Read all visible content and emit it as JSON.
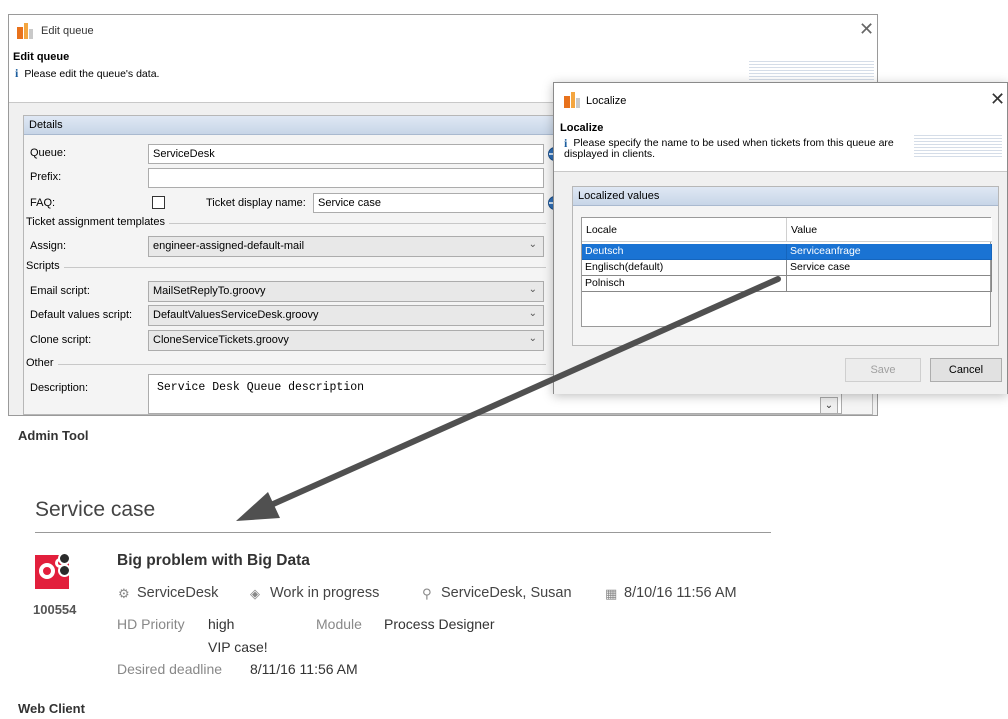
{
  "edit_window": {
    "title": "Edit queue",
    "header_title": "Edit queue",
    "header_text": "Please edit the queue's data.",
    "panel_title": "Details",
    "queue_label": "Queue:",
    "queue_value": "ServiceDesk",
    "prefix_label": "Prefix:",
    "prefix_value": "",
    "faq_label": "FAQ:",
    "faq_checked": false,
    "ticket_display_label": "Ticket display name:",
    "ticket_display_value": "Service case",
    "section_templates": "Ticket assignment templates",
    "assign_label": "Assign:",
    "assign_value": "engineer-assigned-default-mail",
    "section_scripts": "Scripts",
    "email_script_label": "Email script:",
    "email_script_value": "MailSetReplyTo.groovy",
    "default_script_label": "Default values script:",
    "default_script_value": "DefaultValuesServiceDesk.groovy",
    "clone_script_label": "Clone script:",
    "clone_script_value": "CloneServiceTickets.groovy",
    "section_other": "Other",
    "description_label": "Description:",
    "description_value": "Service Desk Queue description"
  },
  "localize_dialog": {
    "title": "Localize",
    "header_title": "Localize",
    "header_text": "Please specify the name to be used when tickets from this queue are displayed in clients.",
    "panel_title": "Localized values",
    "columns": [
      "Locale",
      "Value"
    ],
    "rows": [
      {
        "locale": "Deutsch",
        "value": "Serviceanfrage",
        "selected": true
      },
      {
        "locale": "Englisch(default)",
        "value": "Service case",
        "selected": false
      },
      {
        "locale": "Polnisch",
        "value": "",
        "selected": false
      }
    ],
    "save_label": "Save",
    "cancel_label": "Cancel"
  },
  "captions": {
    "admin_tool": "Admin Tool",
    "web_client": "Web Client"
  },
  "web_client": {
    "section_title": "Service case",
    "ticket_number": "100554",
    "subject": "Big problem with Big Data",
    "queue": "ServiceDesk",
    "status": "Work in progress",
    "assignee": "ServiceDesk, Susan",
    "date": "8/10/16 11:56 AM",
    "hd_priority_label": "HD Priority",
    "hd_priority_value": "high",
    "module_label": "Module",
    "module_value": "Process Designer",
    "vip_text": "VIP case!",
    "deadline_label": "Desired deadline",
    "deadline_value": "8/11/16 11:56 AM"
  },
  "colors": {
    "selection": "#1a73d3",
    "ticket_icon": "#e21f3c",
    "info_icon": "#1d5e9e",
    "arrow": "#505050"
  },
  "icons": {
    "window_icon": "app-logo-icon",
    "queue_icon": "gear-outline-icon",
    "status_icon": "diamond-status-icon",
    "assignee_icon": "person-icon",
    "date_icon": "calendar-icon"
  }
}
